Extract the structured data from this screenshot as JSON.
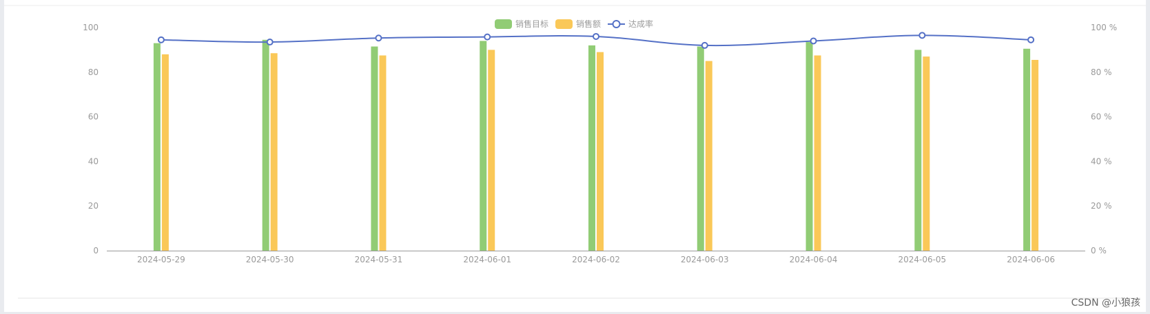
{
  "chart_data": {
    "type": "bar",
    "categories": [
      "2024-05-29",
      "2024-05-30",
      "2024-05-31",
      "2024-06-01",
      "2024-06-02",
      "2024-06-03",
      "2024-06-04",
      "2024-06-05",
      "2024-06-06"
    ],
    "series": [
      {
        "name": "销售目标",
        "type": "bar",
        "axis": "left",
        "color": "#91cc75",
        "values": [
          93,
          94.5,
          91.5,
          94,
          92,
          91.5,
          93.5,
          90,
          90.5
        ]
      },
      {
        "name": "销售额",
        "type": "bar",
        "axis": "left",
        "color": "#fac858",
        "values": [
          88,
          88.5,
          87.5,
          90,
          89,
          85,
          87.5,
          87,
          85.5
        ]
      },
      {
        "name": "达成率",
        "type": "line",
        "axis": "right",
        "color": "#5470c6",
        "unit": "%",
        "values": [
          94.5,
          93.5,
          95.3,
          95.8,
          96,
          92,
          94,
          96.5,
          94.5
        ]
      }
    ],
    "y_left": {
      "min": 0,
      "max": 100,
      "ticks": [
        "0",
        "20",
        "40",
        "60",
        "80",
        "100"
      ]
    },
    "y_right": {
      "min": 0,
      "max": 100,
      "ticks": [
        "0 %",
        "20 %",
        "40 %",
        "60 %",
        "80 %",
        "100 %"
      ]
    },
    "legend_position": "top-center",
    "grid": false
  },
  "watermark": "CSDN @小狼孩"
}
